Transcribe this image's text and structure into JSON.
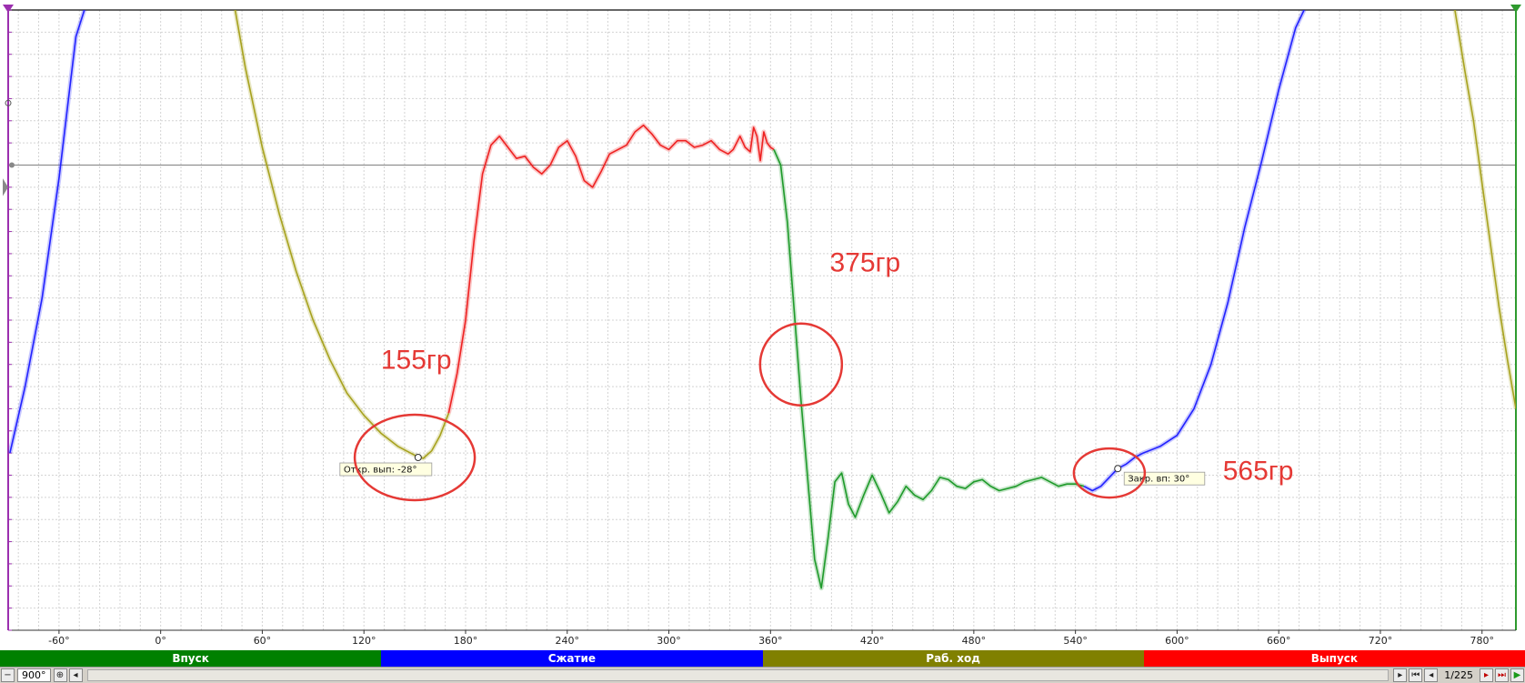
{
  "chart_data": {
    "type": "line",
    "title": "",
    "xlabel": "",
    "ylabel": "",
    "xlim": [
      -90,
      800
    ],
    "ylim": [
      -4,
      10
    ],
    "grid": true,
    "x_ticks": [
      -60,
      0,
      60,
      120,
      180,
      240,
      300,
      360,
      420,
      480,
      540,
      600,
      660,
      720,
      780
    ],
    "x_tick_labels": [
      "-60°",
      "0°",
      "60°",
      "120°",
      "180°",
      "240°",
      "300°",
      "360°",
      "420°",
      "480°",
      "540°",
      "600°",
      "660°",
      "720°",
      "780°"
    ],
    "series": [
      {
        "color": "#2222ff",
        "x": [
          -89,
          -80,
          -70,
          -60,
          -50,
          -45
        ],
        "y": [
          0,
          1.5,
          3.5,
          6.2,
          9.4,
          10
        ]
      },
      {
        "color": "#a7a21e",
        "x": [
          44,
          50,
          60,
          70,
          80,
          90,
          100,
          110,
          120,
          130,
          140,
          150,
          155,
          160,
          165,
          170
        ],
        "y": [
          10,
          8.7,
          6.9,
          5.4,
          4.1,
          3.0,
          2.1,
          1.35,
          0.85,
          0.45,
          0.15,
          -0.05,
          -0.12,
          0.05,
          0.4,
          0.9
        ]
      },
      {
        "color": "#ee2222",
        "x": [
          170,
          175,
          180,
          185,
          190,
          195,
          200,
          205,
          210,
          215,
          220,
          225,
          230,
          235,
          240,
          245,
          250,
          255,
          260,
          265,
          270,
          275,
          280,
          285,
          290,
          295,
          300,
          305,
          310,
          315,
          320,
          325,
          330,
          335,
          338,
          342,
          345,
          348,
          350,
          352,
          354,
          356,
          358,
          360,
          362
        ],
        "y": [
          0.9,
          1.8,
          3.0,
          4.8,
          6.3,
          6.95,
          7.15,
          6.9,
          6.65,
          6.7,
          6.45,
          6.3,
          6.5,
          6.9,
          7.05,
          6.7,
          6.15,
          6.0,
          6.35,
          6.75,
          6.85,
          6.95,
          7.25,
          7.4,
          7.2,
          6.95,
          6.85,
          7.05,
          7.05,
          6.9,
          6.95,
          7.05,
          6.85,
          6.75,
          6.85,
          7.15,
          6.9,
          6.8,
          7.35,
          7.15,
          6.6,
          7.25,
          7.0,
          6.9,
          6.85
        ]
      },
      {
        "color": "#1e9a2a",
        "x": [
          362,
          366,
          370,
          374,
          378,
          382,
          386,
          390,
          394,
          398,
          402,
          406,
          410,
          415,
          420,
          425,
          430,
          435,
          440,
          445,
          450,
          455,
          460,
          465,
          470,
          475,
          480,
          485,
          490,
          495,
          500,
          505,
          510,
          515,
          520,
          525,
          530,
          535,
          540,
          545
        ],
        "y": [
          6.85,
          6.5,
          5.2,
          3.2,
          1.2,
          -0.6,
          -2.4,
          -3.05,
          -1.9,
          -0.65,
          -0.45,
          -1.15,
          -1.45,
          -0.95,
          -0.5,
          -0.9,
          -1.35,
          -1.1,
          -0.75,
          -0.95,
          -1.05,
          -0.85,
          -0.55,
          -0.6,
          -0.75,
          -0.8,
          -0.65,
          -0.6,
          -0.75,
          -0.85,
          -0.8,
          -0.75,
          -0.65,
          -0.6,
          -0.55,
          -0.65,
          -0.75,
          -0.7,
          -0.7,
          -0.75
        ]
      },
      {
        "color": "#2222ff",
        "x": [
          545,
          550,
          555,
          560,
          565,
          570,
          575,
          580,
          590,
          600,
          610,
          620,
          630,
          640,
          650,
          660,
          670,
          675
        ],
        "y": [
          -0.75,
          -0.85,
          -0.75,
          -0.55,
          -0.35,
          -0.25,
          -0.1,
          0.0,
          0.15,
          0.4,
          1.0,
          2.0,
          3.4,
          5.1,
          6.6,
          8.2,
          9.6,
          10
        ]
      },
      {
        "color": "#a7a21e",
        "x": [
          764,
          770,
          775,
          780,
          785,
          790,
          795,
          800
        ],
        "y": [
          10,
          8.6,
          7.5,
          6.1,
          4.7,
          3.3,
          2.1,
          1.0
        ]
      }
    ],
    "phases": [
      {
        "label": "Впуск",
        "color": "#008000"
      },
      {
        "label": "Сжатие",
        "color": "#0000ff"
      },
      {
        "label": "Раб. ход",
        "color": "#808000"
      },
      {
        "label": "Выпуск",
        "color": "#ff0000"
      }
    ],
    "markers": [
      {
        "label": "Откр. вып: -28°",
        "x": 152,
        "y": -0.1
      },
      {
        "label": "Закр. вп: 30°",
        "x": 565,
        "y": -0.35
      }
    ],
    "annotations": [
      {
        "text": "155гр",
        "circle": {
          "x": 150,
          "y": -0.1
        },
        "text_at": {
          "x": 130,
          "y": 1.9
        }
      },
      {
        "text": "375гр",
        "circle": {
          "x": 378,
          "y": 2.0
        },
        "text_at": {
          "x": 395,
          "y": 4.1
        }
      },
      {
        "text": "565гр",
        "circle": {
          "x": 560,
          "y": -0.45
        },
        "text_at": {
          "x": 627,
          "y": -0.6
        }
      }
    ],
    "annotation_color": "#e53935"
  },
  "toolbar": {
    "zoom_label": "900°",
    "page_counter": "1/225"
  }
}
